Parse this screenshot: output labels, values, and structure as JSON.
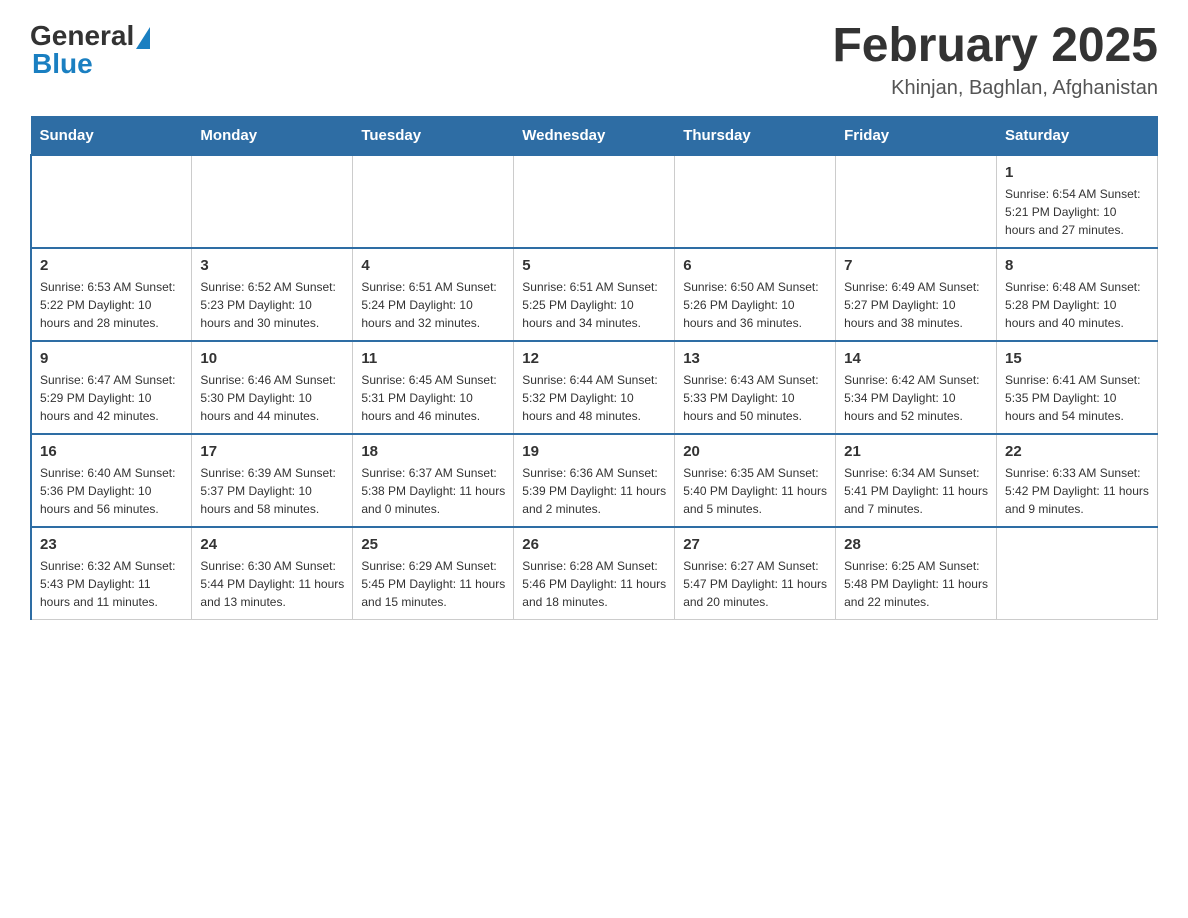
{
  "header": {
    "logo": {
      "general": "General",
      "blue": "Blue"
    },
    "title": "February 2025",
    "subtitle": "Khinjan, Baghlan, Afghanistan"
  },
  "weekdays": [
    "Sunday",
    "Monday",
    "Tuesday",
    "Wednesday",
    "Thursday",
    "Friday",
    "Saturday"
  ],
  "weeks": [
    [
      {
        "day": "",
        "info": ""
      },
      {
        "day": "",
        "info": ""
      },
      {
        "day": "",
        "info": ""
      },
      {
        "day": "",
        "info": ""
      },
      {
        "day": "",
        "info": ""
      },
      {
        "day": "",
        "info": ""
      },
      {
        "day": "1",
        "info": "Sunrise: 6:54 AM\nSunset: 5:21 PM\nDaylight: 10 hours and 27 minutes."
      }
    ],
    [
      {
        "day": "2",
        "info": "Sunrise: 6:53 AM\nSunset: 5:22 PM\nDaylight: 10 hours and 28 minutes."
      },
      {
        "day": "3",
        "info": "Sunrise: 6:52 AM\nSunset: 5:23 PM\nDaylight: 10 hours and 30 minutes."
      },
      {
        "day": "4",
        "info": "Sunrise: 6:51 AM\nSunset: 5:24 PM\nDaylight: 10 hours and 32 minutes."
      },
      {
        "day": "5",
        "info": "Sunrise: 6:51 AM\nSunset: 5:25 PM\nDaylight: 10 hours and 34 minutes."
      },
      {
        "day": "6",
        "info": "Sunrise: 6:50 AM\nSunset: 5:26 PM\nDaylight: 10 hours and 36 minutes."
      },
      {
        "day": "7",
        "info": "Sunrise: 6:49 AM\nSunset: 5:27 PM\nDaylight: 10 hours and 38 minutes."
      },
      {
        "day": "8",
        "info": "Sunrise: 6:48 AM\nSunset: 5:28 PM\nDaylight: 10 hours and 40 minutes."
      }
    ],
    [
      {
        "day": "9",
        "info": "Sunrise: 6:47 AM\nSunset: 5:29 PM\nDaylight: 10 hours and 42 minutes."
      },
      {
        "day": "10",
        "info": "Sunrise: 6:46 AM\nSunset: 5:30 PM\nDaylight: 10 hours and 44 minutes."
      },
      {
        "day": "11",
        "info": "Sunrise: 6:45 AM\nSunset: 5:31 PM\nDaylight: 10 hours and 46 minutes."
      },
      {
        "day": "12",
        "info": "Sunrise: 6:44 AM\nSunset: 5:32 PM\nDaylight: 10 hours and 48 minutes."
      },
      {
        "day": "13",
        "info": "Sunrise: 6:43 AM\nSunset: 5:33 PM\nDaylight: 10 hours and 50 minutes."
      },
      {
        "day": "14",
        "info": "Sunrise: 6:42 AM\nSunset: 5:34 PM\nDaylight: 10 hours and 52 minutes."
      },
      {
        "day": "15",
        "info": "Sunrise: 6:41 AM\nSunset: 5:35 PM\nDaylight: 10 hours and 54 minutes."
      }
    ],
    [
      {
        "day": "16",
        "info": "Sunrise: 6:40 AM\nSunset: 5:36 PM\nDaylight: 10 hours and 56 minutes."
      },
      {
        "day": "17",
        "info": "Sunrise: 6:39 AM\nSunset: 5:37 PM\nDaylight: 10 hours and 58 minutes."
      },
      {
        "day": "18",
        "info": "Sunrise: 6:37 AM\nSunset: 5:38 PM\nDaylight: 11 hours and 0 minutes."
      },
      {
        "day": "19",
        "info": "Sunrise: 6:36 AM\nSunset: 5:39 PM\nDaylight: 11 hours and 2 minutes."
      },
      {
        "day": "20",
        "info": "Sunrise: 6:35 AM\nSunset: 5:40 PM\nDaylight: 11 hours and 5 minutes."
      },
      {
        "day": "21",
        "info": "Sunrise: 6:34 AM\nSunset: 5:41 PM\nDaylight: 11 hours and 7 minutes."
      },
      {
        "day": "22",
        "info": "Sunrise: 6:33 AM\nSunset: 5:42 PM\nDaylight: 11 hours and 9 minutes."
      }
    ],
    [
      {
        "day": "23",
        "info": "Sunrise: 6:32 AM\nSunset: 5:43 PM\nDaylight: 11 hours and 11 minutes."
      },
      {
        "day": "24",
        "info": "Sunrise: 6:30 AM\nSunset: 5:44 PM\nDaylight: 11 hours and 13 minutes."
      },
      {
        "day": "25",
        "info": "Sunrise: 6:29 AM\nSunset: 5:45 PM\nDaylight: 11 hours and 15 minutes."
      },
      {
        "day": "26",
        "info": "Sunrise: 6:28 AM\nSunset: 5:46 PM\nDaylight: 11 hours and 18 minutes."
      },
      {
        "day": "27",
        "info": "Sunrise: 6:27 AM\nSunset: 5:47 PM\nDaylight: 11 hours and 20 minutes."
      },
      {
        "day": "28",
        "info": "Sunrise: 6:25 AM\nSunset: 5:48 PM\nDaylight: 11 hours and 22 minutes."
      },
      {
        "day": "",
        "info": ""
      }
    ]
  ]
}
